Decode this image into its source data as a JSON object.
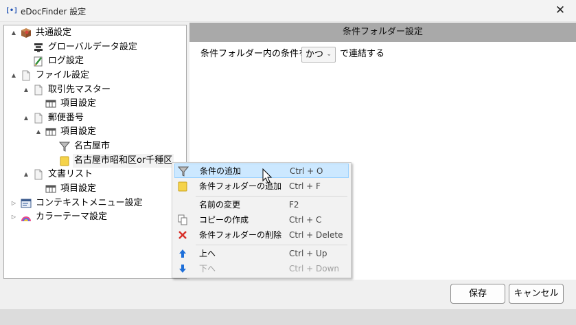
{
  "window": {
    "title": "eDocFinder 設定",
    "app_icon": "[•]"
  },
  "tree": {
    "items": [
      {
        "label": "共通設定",
        "icon": "package-icon",
        "expander": "▲"
      },
      {
        "label": "グローバルデータ設定",
        "icon": "database-icon",
        "expander": ""
      },
      {
        "label": "ログ設定",
        "icon": "log-edit-icon",
        "expander": ""
      },
      {
        "label": "ファイル設定",
        "icon": "file-icon",
        "expander": "▲"
      },
      {
        "label": "取引先マスター",
        "icon": "file-icon",
        "expander": "▲"
      },
      {
        "label": "項目設定",
        "icon": "table-icon",
        "expander": ""
      },
      {
        "label": "郵便番号",
        "icon": "file-icon",
        "expander": "▲"
      },
      {
        "label": "項目設定",
        "icon": "table-icon",
        "expander": "▲"
      },
      {
        "label": "名古屋市",
        "icon": "filter-icon",
        "expander": ""
      },
      {
        "label": "名古屋市昭和区or千種区",
        "icon": "folder-icon",
        "expander": ""
      },
      {
        "label": "文書リスト",
        "icon": "file-icon",
        "expander": "▲"
      },
      {
        "label": "項目設定",
        "icon": "table-icon",
        "expander": ""
      },
      {
        "label": "コンテキストメニュー設定",
        "icon": "context-menu-icon",
        "expander": "▷"
      },
      {
        "label": "カラーテーマ設定",
        "icon": "color-theme-icon",
        "expander": "▷"
      }
    ]
  },
  "panel": {
    "header": "条件フォルダー設定",
    "condition_prefix": "条件フォルダー内の条件を",
    "condition_value": "かつ",
    "condition_suffix": "で連結する"
  },
  "buttons": {
    "save": "保存",
    "cancel": "キャンセル"
  },
  "context_menu": {
    "items": [
      {
        "label": "条件の追加",
        "shortcut": "Ctrl + O",
        "icon": "filter-icon"
      },
      {
        "label": "条件フォルダーの追加",
        "shortcut": "Ctrl + F",
        "icon": "folder-icon"
      },
      {
        "label": "名前の変更",
        "shortcut": "F2",
        "icon": ""
      },
      {
        "label": "コピーの作成",
        "shortcut": "Ctrl + C",
        "icon": "copy-icon"
      },
      {
        "label": "条件フォルダーの削除",
        "shortcut": "Ctrl + Delete",
        "icon": "delete-icon"
      },
      {
        "label": "上へ",
        "shortcut": "Ctrl + Up",
        "icon": "arrow-up-icon"
      },
      {
        "label": "下へ",
        "shortcut": "Ctrl + Down",
        "icon": "arrow-down-icon"
      }
    ],
    "hovered_item": "条件の追加",
    "disabled_item": "下へ"
  },
  "colors": {
    "panel_header": "#a9a9a9",
    "menu_hover": "#cce8ff",
    "arrow_blue": "#1e6fd9",
    "delete_red": "#d8312a",
    "folder_yellow": "#f5d34a"
  }
}
